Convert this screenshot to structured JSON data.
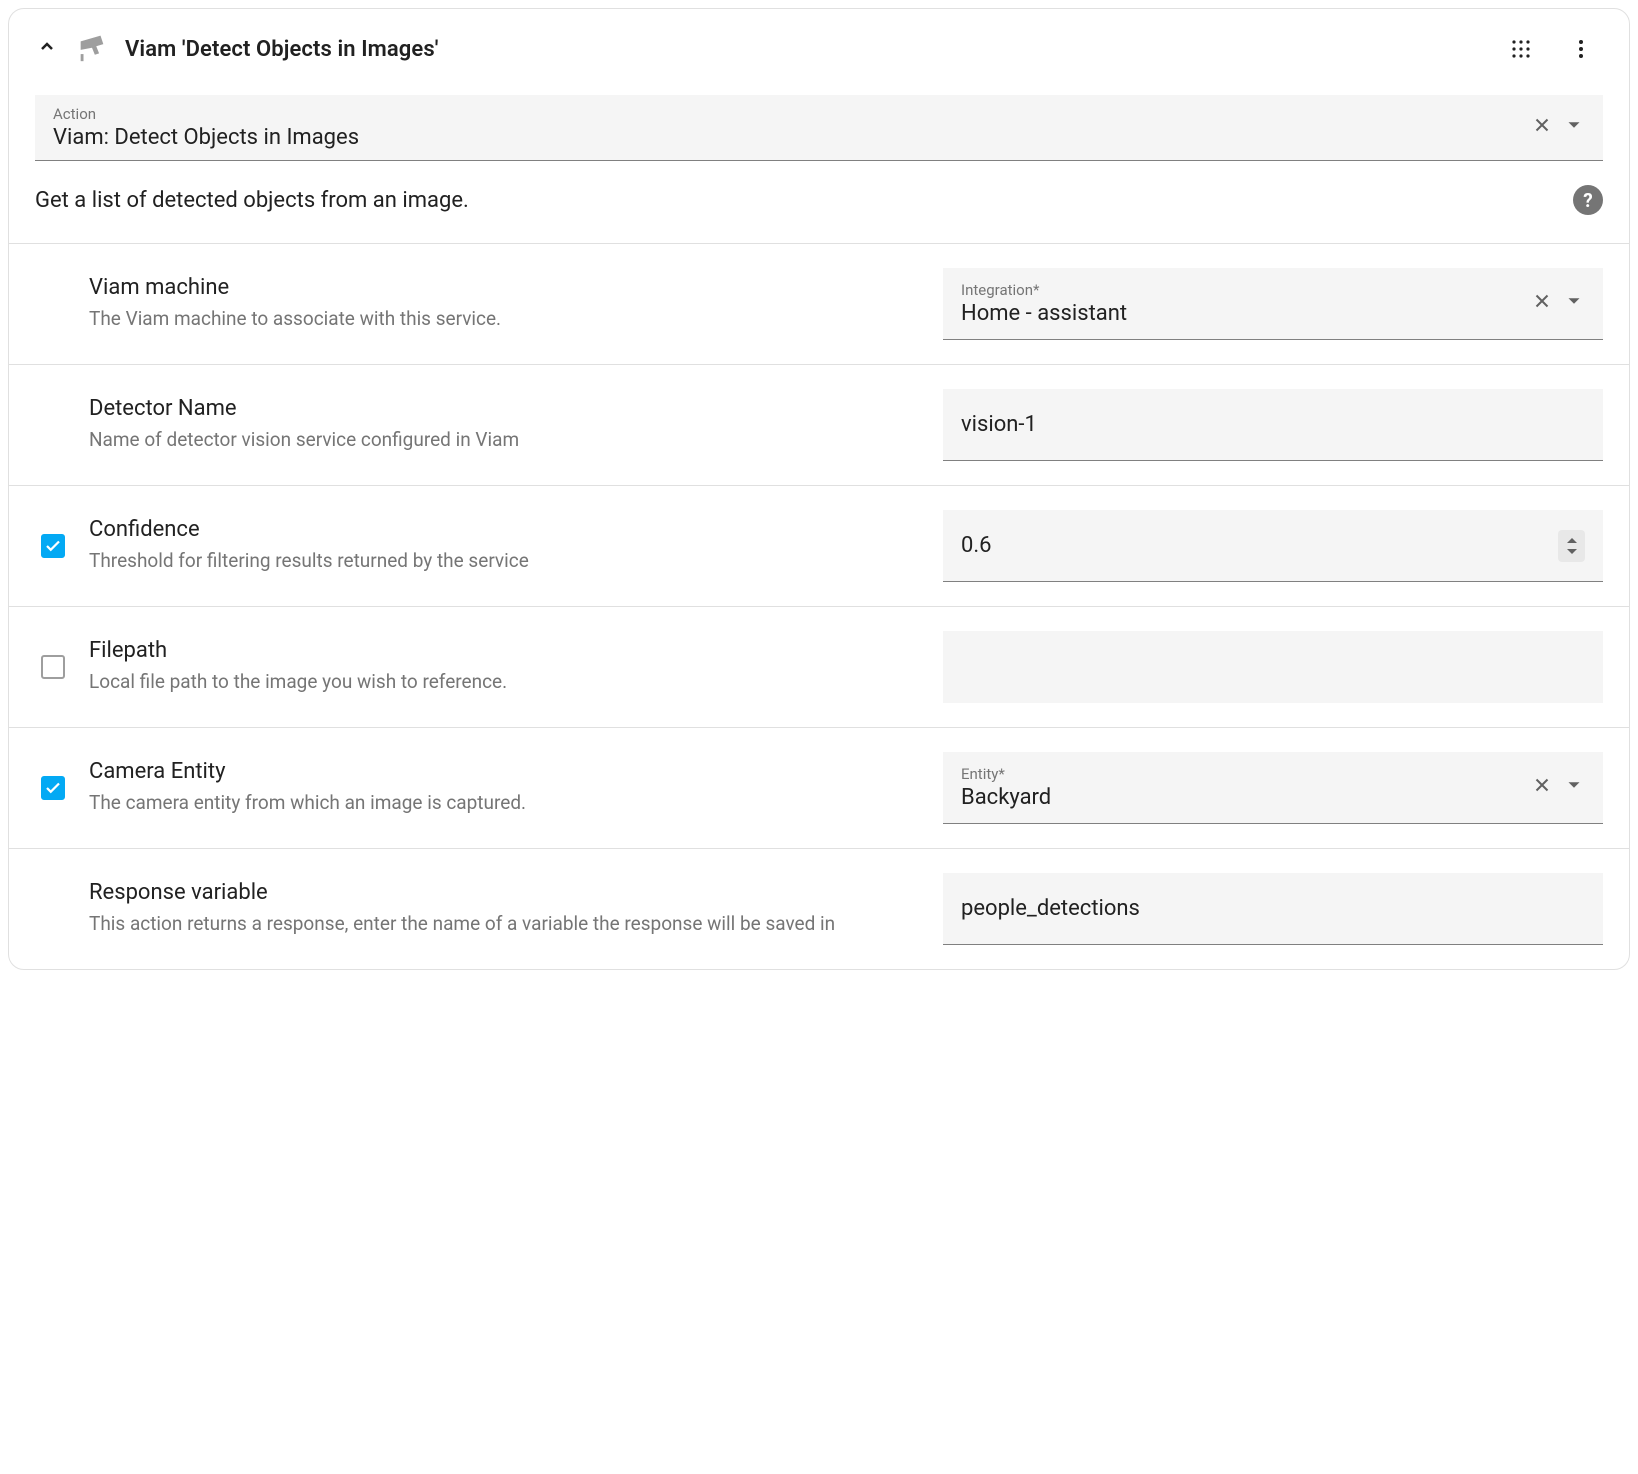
{
  "header": {
    "title": "Viam 'Detect Objects in Images'"
  },
  "action": {
    "label": "Action",
    "value": "Viam: Detect Objects in Images"
  },
  "description": "Get a list of detected objects from an image.",
  "fields": {
    "viam_machine": {
      "title": "Viam machine",
      "desc": "The Viam machine to associate with this service.",
      "control_label": "Integration*",
      "control_value": "Home - assistant"
    },
    "detector_name": {
      "title": "Detector Name",
      "desc": "Name of detector vision service configured in Viam",
      "control_value": "vision-1"
    },
    "confidence": {
      "title": "Confidence",
      "desc": "Threshold for filtering results returned by the service",
      "control_value": "0.6",
      "checked": true
    },
    "filepath": {
      "title": "Filepath",
      "desc": "Local file path to the image you wish to reference.",
      "control_value": "",
      "checked": false
    },
    "camera_entity": {
      "title": "Camera Entity",
      "desc": "The camera entity from which an image is captured.",
      "control_label": "Entity*",
      "control_value": "Backyard",
      "checked": true
    },
    "response_variable": {
      "title": "Response variable",
      "desc": "This action returns a response, enter the name of a variable the response will be saved in",
      "control_value": "people_detections"
    }
  }
}
